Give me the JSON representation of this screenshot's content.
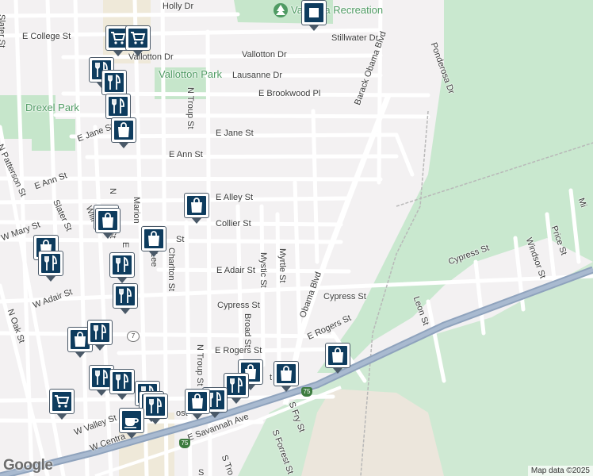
{
  "streets": [
    {
      "id": "holly-dr",
      "text": "Holly Dr"
    },
    {
      "id": "slater-st-n",
      "text": "Slater St"
    },
    {
      "id": "e-college-st",
      "text": "E College St"
    },
    {
      "id": "stillwater-dr",
      "text": "Stillwater Dr"
    },
    {
      "id": "vallotton-dr-w",
      "text": "Vallotton Dr"
    },
    {
      "id": "vallotton-dr-e",
      "text": "Vallotton Dr"
    },
    {
      "id": "lausanne-dr",
      "text": "Lausanne Dr"
    },
    {
      "id": "e-brookwood-pl",
      "text": "E Brookwood Pl"
    },
    {
      "id": "ponderosa-dr",
      "text": "Ponderosa Dr"
    },
    {
      "id": "n-troup-st",
      "text": "N Troup St"
    },
    {
      "id": "barack-obama-blvd",
      "text": "Barack Obama Blvd"
    },
    {
      "id": "n-patterson-st",
      "text": "N Patterson St"
    },
    {
      "id": "e-jane-st-w",
      "text": "E Jane St"
    },
    {
      "id": "e-jane-st",
      "text": "E Jane St"
    },
    {
      "id": "e-ann-st",
      "text": "E Ann St"
    },
    {
      "id": "e-ann-st-w",
      "text": "E Ann St"
    },
    {
      "id": "e-alley-st",
      "text": "E Alley St"
    },
    {
      "id": "collier-st",
      "text": "Collier St"
    },
    {
      "id": "w-mary-st",
      "text": "W Mary St"
    },
    {
      "id": "slater-st",
      "text": "Slater St"
    },
    {
      "id": "marion-st",
      "text": "Marion"
    },
    {
      "id": "wi-st",
      "text": "Willi"
    },
    {
      "id": "n-ashley",
      "text": "N"
    },
    {
      "id": "ashley-st",
      "text": "St"
    },
    {
      "id": "e-lee",
      "text": "E"
    },
    {
      "id": "lee-st",
      "text": "Lee"
    },
    {
      "id": "park-st",
      "text": "St"
    },
    {
      "id": "charlton-st",
      "text": "Charlton St"
    },
    {
      "id": "mystic-st",
      "text": "Mystic St"
    },
    {
      "id": "myrtle-st",
      "text": "Myrtle St"
    },
    {
      "id": "e-adair-st",
      "text": "E Adair St"
    },
    {
      "id": "w-adair-st",
      "text": "W Adair St"
    },
    {
      "id": "n-oak-st",
      "text": "N Oak St"
    },
    {
      "id": "cypress-st-1",
      "text": "Cypress St"
    },
    {
      "id": "cypress-st-2",
      "text": "Cypress St"
    },
    {
      "id": "cypress-st-3",
      "text": "Cypress St"
    },
    {
      "id": "windsor-st",
      "text": "Windsor St"
    },
    {
      "id": "price-st",
      "text": "Price St"
    },
    {
      "id": "mi-st",
      "text": "Mi"
    },
    {
      "id": "leon-st",
      "text": "Leon St"
    },
    {
      "id": "broad-st",
      "text": "Broad St"
    },
    {
      "id": "n-troup-st-2",
      "text": "N Troup St"
    },
    {
      "id": "e-rogers-st",
      "text": "E Rogers St"
    },
    {
      "id": "e-rogers-st-2",
      "text": "E Rogers St"
    },
    {
      "id": "obama-blvd",
      "text": "Obama Blvd"
    },
    {
      "id": "rogers-st-frag",
      "text": "t"
    },
    {
      "id": "s-fry-st",
      "text": "S Fry St"
    },
    {
      "id": "s-forrest-st",
      "text": "S Forrest St"
    },
    {
      "id": "s-troup",
      "text": "S Tro"
    },
    {
      "id": "e-savannah-ave",
      "text": "E Savannah Ave"
    },
    {
      "id": "w-valley-st",
      "text": "W Valley St"
    },
    {
      "id": "w-central",
      "text": "W Centra"
    },
    {
      "id": "s-lee",
      "text": "S"
    },
    {
      "id": "valdosta-frag",
      "text": "ost"
    }
  ],
  "parks": [
    {
      "id": "valdosta-recreation",
      "text": "Valdosta Recreation"
    },
    {
      "id": "vallotton-park",
      "text": "Vallotton Park"
    },
    {
      "id": "drexel-park",
      "text": "Drexel Park"
    }
  ],
  "shields": [
    {
      "id": "us-7",
      "text": "7"
    },
    {
      "id": "i-75-a",
      "text": "75"
    },
    {
      "id": "i-75-b",
      "text": "75"
    }
  ],
  "markers": [
    {
      "kind": "grocery"
    },
    {
      "kind": "grocery"
    },
    {
      "kind": "restaurant"
    },
    {
      "kind": "restaurant"
    },
    {
      "kind": "restaurant"
    },
    {
      "kind": "shopping"
    },
    {
      "kind": "shopping"
    },
    {
      "kind": "shopping"
    },
    {
      "kind": "shopping"
    },
    {
      "kind": "shopping"
    },
    {
      "kind": "shopping"
    },
    {
      "kind": "restaurant"
    },
    {
      "kind": "restaurant"
    },
    {
      "kind": "restaurant"
    },
    {
      "kind": "shopping"
    },
    {
      "kind": "restaurant"
    },
    {
      "kind": "restaurant"
    },
    {
      "kind": "restaurant"
    },
    {
      "kind": "grocery"
    },
    {
      "kind": "restaurant"
    },
    {
      "kind": "restaurant"
    },
    {
      "kind": "shopping"
    },
    {
      "kind": "restaurant"
    },
    {
      "kind": "restaurant"
    },
    {
      "kind": "shopping"
    },
    {
      "kind": "shopping"
    },
    {
      "kind": "restaurant"
    },
    {
      "kind": "cafe"
    },
    {
      "kind": "shopping"
    },
    {
      "kind": "generic"
    }
  ],
  "branding": {
    "logo": "Google",
    "attribution": "Map data ©2025"
  }
}
